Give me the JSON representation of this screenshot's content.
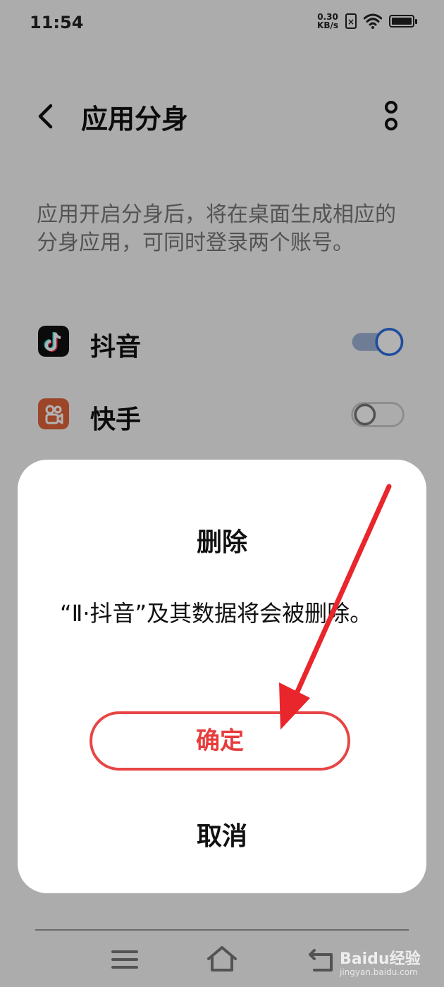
{
  "status_bar": {
    "time": "11:54",
    "netspeed_value": "0.30",
    "netspeed_unit": "KB/s",
    "icons": [
      "sim-x-icon",
      "wifi-icon",
      "battery-icon"
    ]
  },
  "header": {
    "title": "应用分身",
    "back_icon": "chevron-left-icon",
    "more_icon": "more-vertical-icon"
  },
  "description": "应用开启分身后，将在桌面生成相应的分身应用，可同时登录两个账号。",
  "apps": [
    {
      "name": "抖音",
      "icon": "douyin-icon",
      "enabled": true,
      "icon_color": "#111111"
    },
    {
      "name": "快手",
      "icon": "kuaishou-icon",
      "enabled": false,
      "icon_color": "#c8502c"
    }
  ],
  "dialog": {
    "title": "删除",
    "message": "“Ⅱ·抖音”及其数据将会被删除。",
    "confirm_label": "确定",
    "cancel_label": "取消",
    "confirm_color": "#e84545"
  },
  "nav_bar": {
    "icons": [
      "menu-icon",
      "home-icon",
      "back-icon"
    ]
  },
  "watermark": {
    "text": "Baidu经验",
    "sub": "jingyan.baidu.com"
  }
}
